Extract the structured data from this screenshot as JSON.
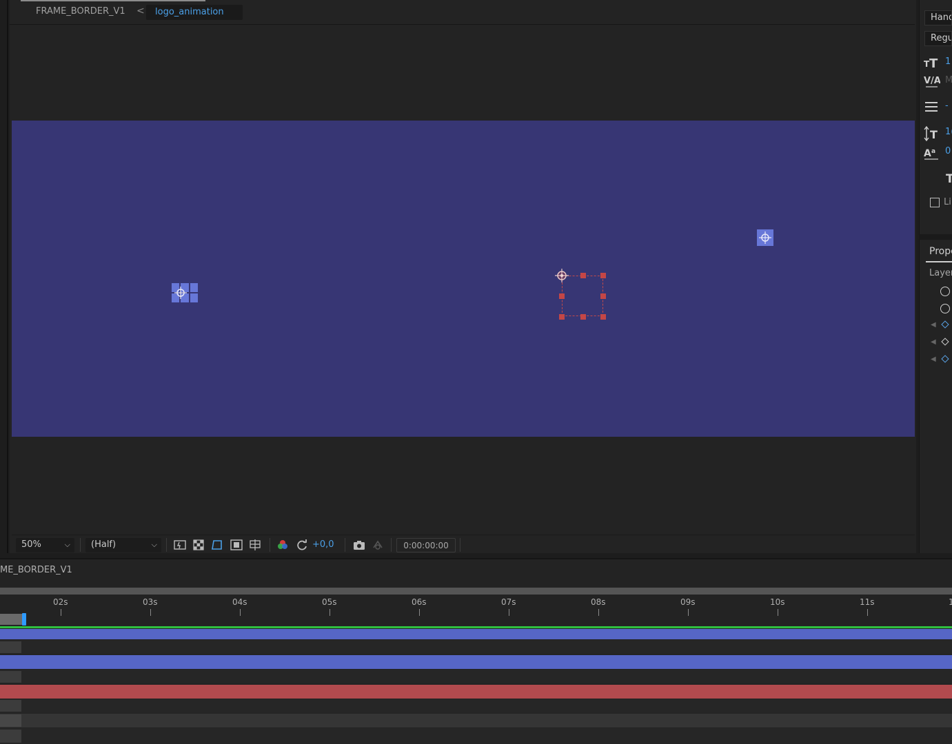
{
  "composition": {
    "parent_name": "FRAME_BORDER_V1",
    "current_name": "logo_animation",
    "separator": "<"
  },
  "viewer": {
    "background_color": "#373674",
    "zoom": "50%",
    "resolution": "(Half)",
    "exposure": "+0,0",
    "timecode": "0:00:00:00",
    "toolbar_icons": [
      "preview-toggle-icon",
      "transparency-grid-icon",
      "mask-path-visibility-icon",
      "region-of-interest-icon",
      "grid-guides-icon",
      "color-channel-icon",
      "reset-exposure-icon",
      "snapshot-icon",
      "show-snapshot-icon"
    ]
  },
  "right_panel": {
    "font_family_field": "Hand",
    "font_style_field": "Regu",
    "font_size_value": "1",
    "kerning_value": "M",
    "leading_value": "-",
    "vertical_scale_value": "1(",
    "baseline_shift_value": "0",
    "ligatures_label": "Li",
    "properties_tab": "Prope",
    "layer_label": "Layer"
  },
  "timeline": {
    "title": "ME_BORDER_V1",
    "ticks": [
      "02s",
      "03s",
      "04s",
      "05s",
      "06s",
      "07s",
      "08s",
      "09s",
      "10s",
      "11s",
      "1"
    ]
  },
  "colors": {
    "accent_blue": "#4ba0e8",
    "layer_blue": "#5666c6",
    "layer_red": "#b24a4e",
    "playhead": "#2f9bff",
    "work_area_green": "#2fbf40"
  }
}
